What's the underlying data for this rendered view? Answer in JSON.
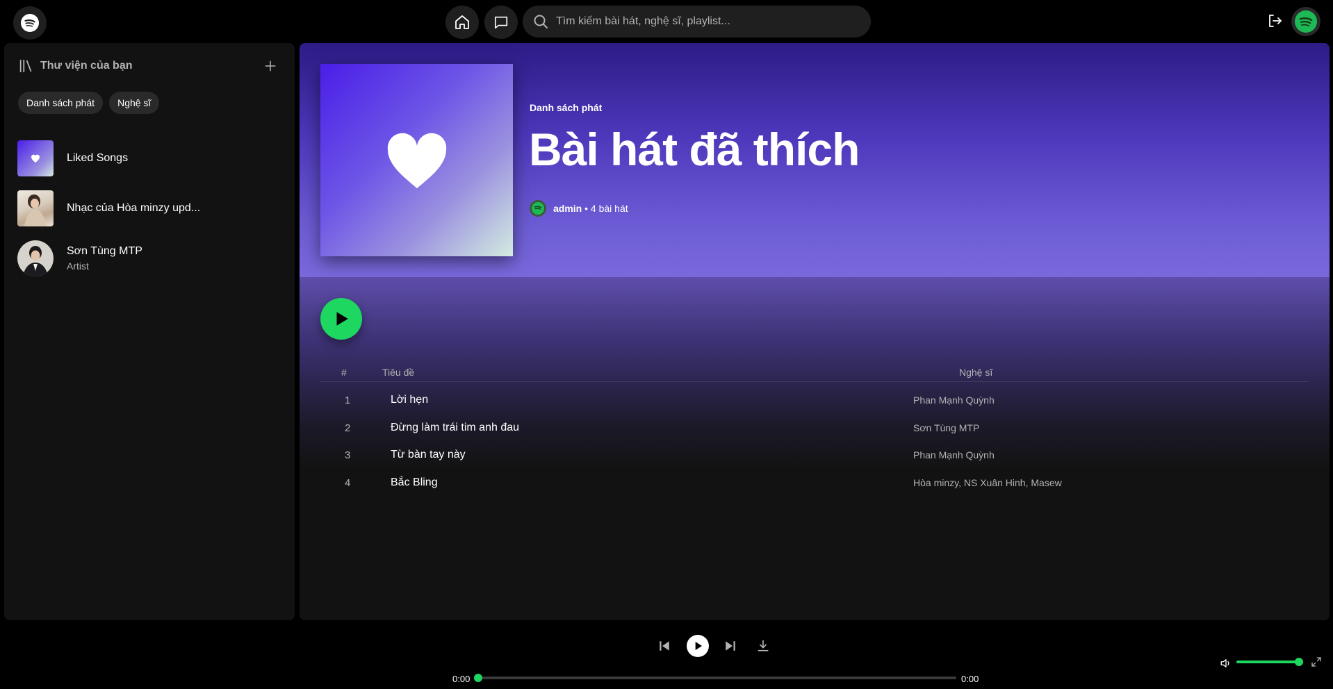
{
  "topbar": {
    "search_placeholder": "Tìm kiếm bài hát, nghệ sĩ, playlist..."
  },
  "sidebar": {
    "title": "Thư viện của bạn",
    "chips": [
      "Danh sách phát",
      "Nghệ sĩ"
    ],
    "items": [
      {
        "title": "Liked Songs",
        "subtitle": ""
      },
      {
        "title": "Nhạc của Hòa minzy upd...",
        "subtitle": ""
      },
      {
        "title": "Sơn Tùng MTP",
        "subtitle": "Artist"
      }
    ]
  },
  "playlist": {
    "type": "Danh sách phát",
    "title": "Bài hát đã thích",
    "owner": "admin",
    "count": "4 bài hát",
    "columns": {
      "num": "#",
      "title": "Tiêu đề",
      "artist": "Nghệ sĩ"
    },
    "tracks": [
      {
        "num": "1",
        "title": "Lời hẹn",
        "artist": "Phan Mạnh Quỳnh"
      },
      {
        "num": "2",
        "title": "Đừng làm trái tim anh đau",
        "artist": "Sơn Tùng MTP"
      },
      {
        "num": "3",
        "title": "Từ bàn tay này",
        "artist": "Phan Mạnh Quỳnh"
      },
      {
        "num": "4",
        "title": "Bắc Bling",
        "artist": "Hòa minzy, NS Xuân Hinh, Masew"
      }
    ]
  },
  "player": {
    "time_current": "0:00",
    "time_total": "0:00",
    "progress": 0,
    "volume": 1.0
  },
  "colors": {
    "accent": "#1ed760",
    "background": "#000000",
    "panel": "#121212"
  }
}
